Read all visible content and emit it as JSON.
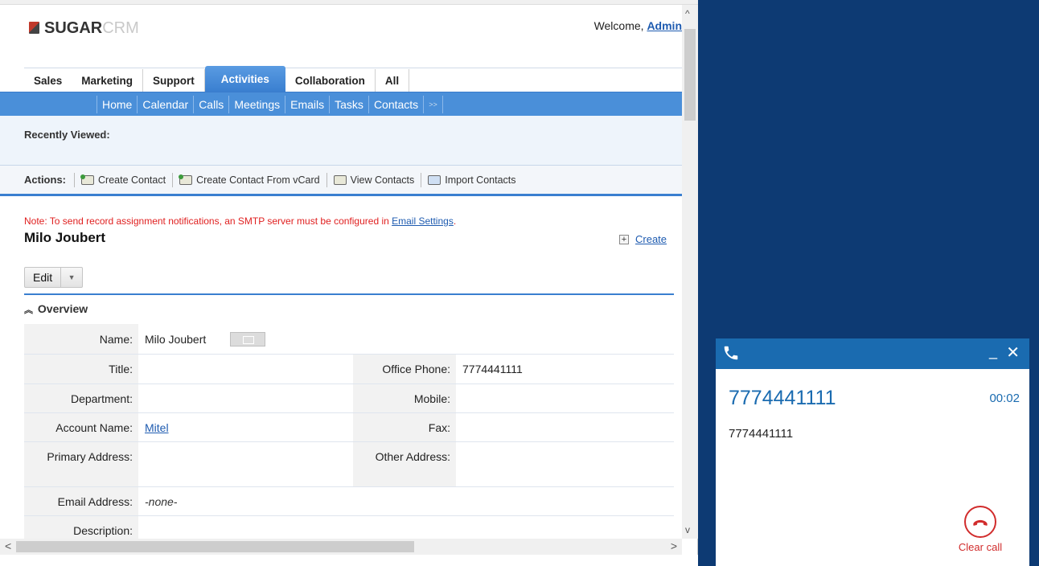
{
  "header": {
    "logo_bold": "SUGAR",
    "logo_light": "CRM",
    "welcome_prefix": "Welcome, ",
    "welcome_user": "Admin"
  },
  "tabs": [
    "Sales",
    "Marketing",
    "Support",
    "Activities",
    "Collaboration",
    "All"
  ],
  "active_tab": "Activities",
  "subtabs": [
    "Home",
    "Calendar",
    "Calls",
    "Meetings",
    "Emails",
    "Tasks",
    "Contacts",
    ">>"
  ],
  "recently_viewed": "Recently Viewed:",
  "actions": {
    "label": "Actions:",
    "items": [
      "Create Contact",
      "Create Contact From vCard",
      "View Contacts",
      "Import Contacts"
    ]
  },
  "note": {
    "text": "Note: To send record assignment notifications, an SMTP server must be configured in ",
    "link": "Email Settings",
    "end": "."
  },
  "record": {
    "title": "Milo Joubert",
    "create_label": "Create",
    "edit_label": "Edit",
    "overview_label": "Overview"
  },
  "fields": {
    "name_label": "Name:",
    "name_value": "Milo Joubert",
    "title_label": "Title:",
    "title_value": "",
    "office_phone_label": "Office Phone:",
    "office_phone_value": "7774441111",
    "department_label": "Department:",
    "department_value": "",
    "mobile_label": "Mobile:",
    "mobile_value": "",
    "account_label": "Account Name:",
    "account_value": "Mitel",
    "fax_label": "Fax:",
    "fax_value": "",
    "primary_address_label": "Primary Address:",
    "primary_address_value": "",
    "other_address_label": "Other Address:",
    "other_address_value": "",
    "email_label": "Email Address:",
    "email_value": "-none-",
    "description_label": "Description:",
    "description_value": ""
  },
  "phone": {
    "number": "7774441111",
    "timer": "00:02",
    "caller": "7774441111",
    "clear_label": "Clear call",
    "minimize": "_",
    "close": "✕"
  },
  "colors": {
    "background": "#0d3a73",
    "sugar_blue": "#3a7fd0",
    "phone_blue": "#1a6bb0",
    "clear_red": "#d12c2c",
    "note_red": "#e02020"
  }
}
